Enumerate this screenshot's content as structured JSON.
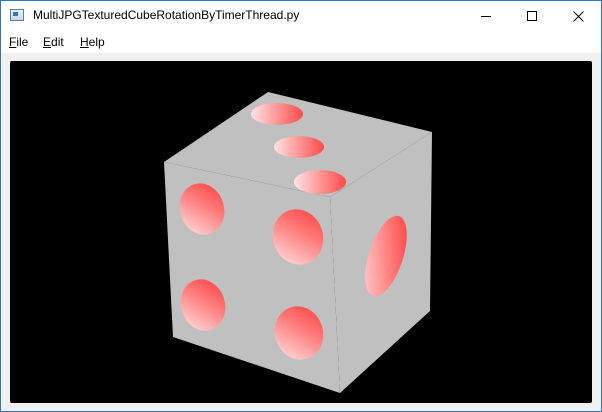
{
  "window": {
    "title": "MultiJPGTexturedCubeRotationByTimerThread.py",
    "icon": "app-window-icon"
  },
  "titlebar_buttons": {
    "minimize": "minimize-icon",
    "maximize": "maximize-icon",
    "close": "close-icon"
  },
  "menu": {
    "items": [
      {
        "accel": "F",
        "rest": "ile"
      },
      {
        "accel": "E",
        "rest": "dit"
      },
      {
        "accel": "H",
        "rest": "elp"
      }
    ]
  },
  "scene": {
    "background_color": "#000000",
    "cube_face_color": "#c0c0c0",
    "pip_color_dark": "#ff4040",
    "pip_color_light": "#ffe0e0"
  }
}
